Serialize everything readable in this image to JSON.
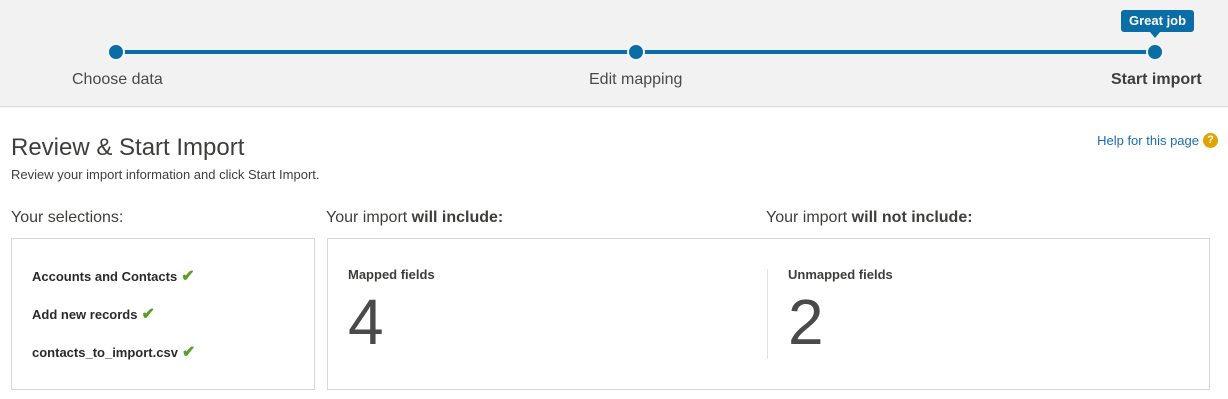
{
  "progress": {
    "steps": [
      {
        "label": "Choose data"
      },
      {
        "label": "Edit mapping"
      },
      {
        "label": "Start import"
      }
    ],
    "tooltip": "Great job",
    "accent_color": "#0b6da6"
  },
  "page": {
    "title": "Review & Start Import",
    "subtitle": "Review your import information and click Start Import.",
    "help_link": "Help for this page",
    "help_icon": "question-icon"
  },
  "sections": {
    "selections_heading": "Your selections:",
    "include_prefix": "Your import ",
    "include_bold": "will include:",
    "exclude_prefix": "Your import ",
    "exclude_bold": "will not include:"
  },
  "selections": [
    {
      "label": "Accounts and Contacts",
      "icon": "check-icon"
    },
    {
      "label": "Add new records",
      "icon": "check-icon"
    },
    {
      "label": "contacts_to_import.csv",
      "icon": "check-icon"
    }
  ],
  "summary": {
    "mapped_label": "Mapped fields",
    "mapped_count": "4",
    "unmapped_label": "Unmapped fields",
    "unmapped_count": "2"
  },
  "colors": {
    "check": "#5a9e2a",
    "help_icon": "#e0a400",
    "link": "#1a6db0"
  }
}
